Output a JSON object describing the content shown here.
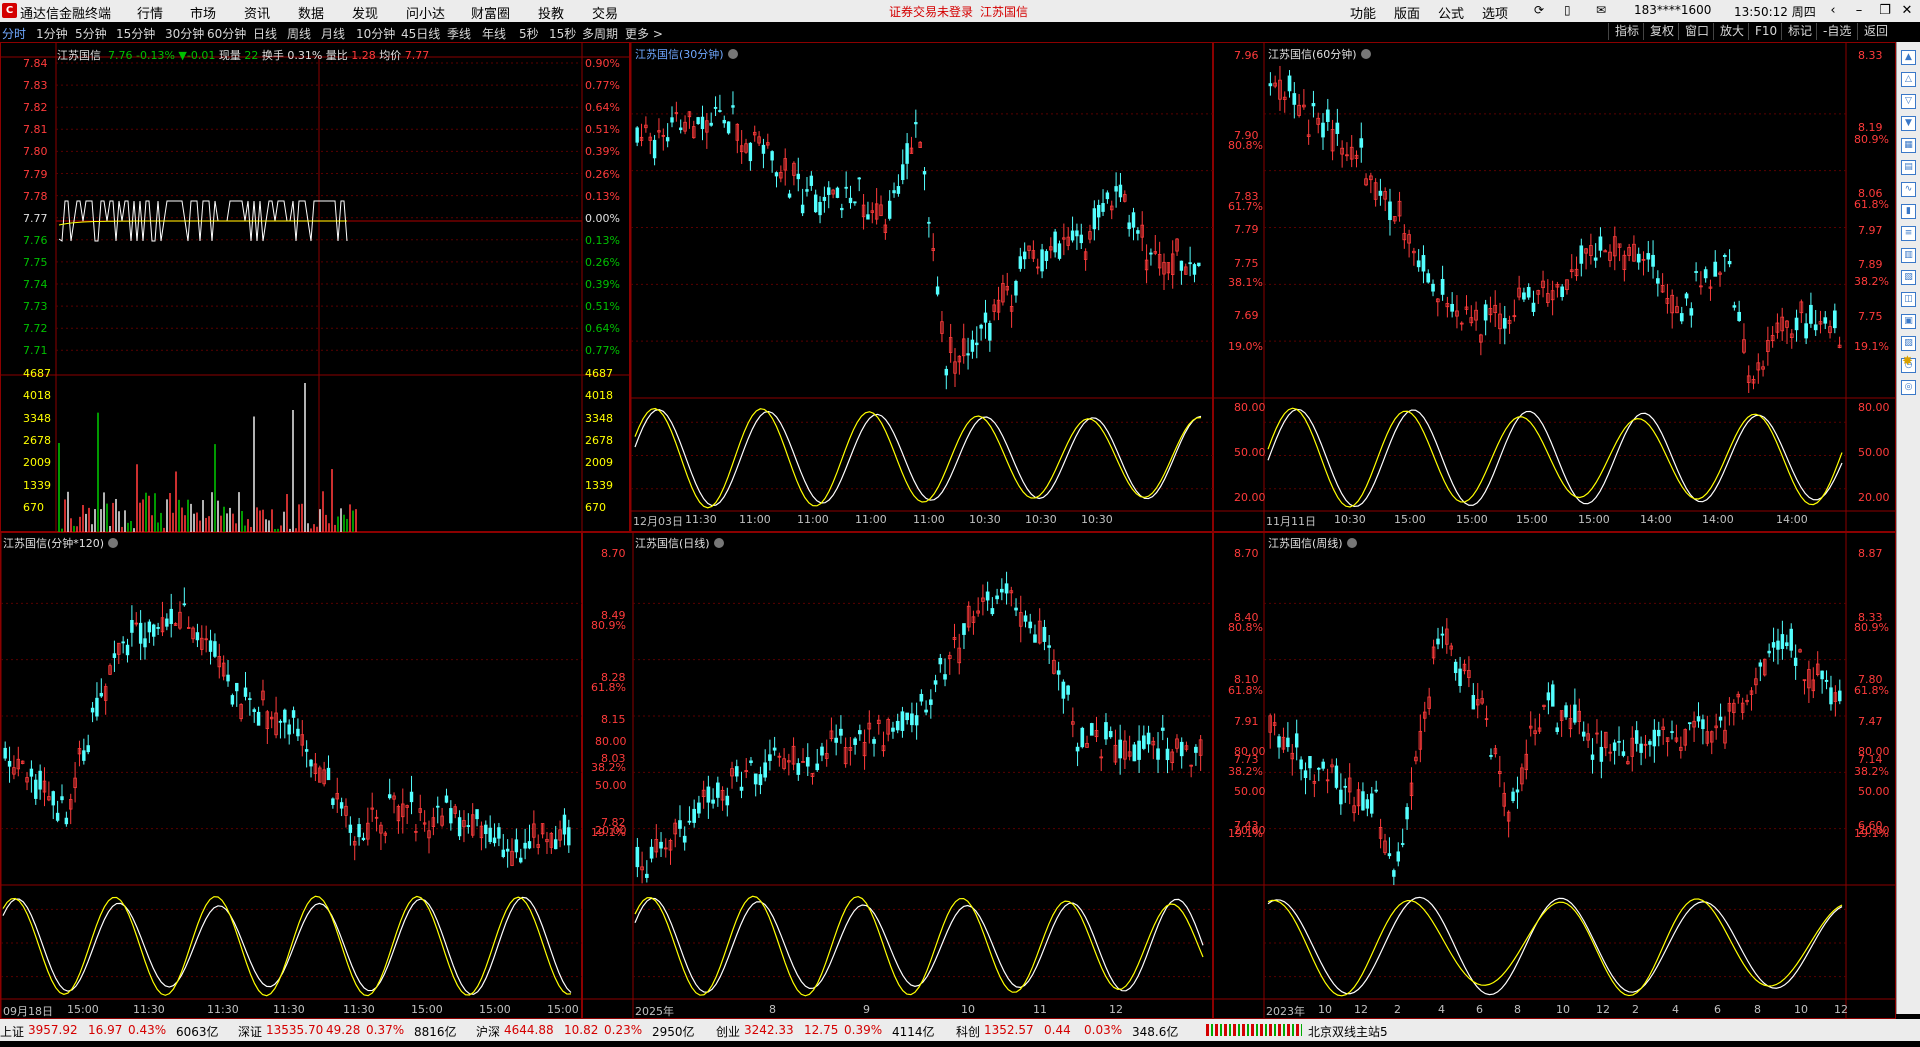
{
  "menubar": {
    "app_title": "通达信金融终端",
    "items": [
      "行情",
      "市场",
      "资讯",
      "数据",
      "发现",
      "问小达",
      "财富圈",
      "投教",
      "交易"
    ],
    "warning": "证券交易未登录",
    "stock": "江苏国信",
    "right_items": [
      "功能",
      "版面",
      "公式",
      "选项"
    ],
    "user": "183****1600",
    "clock": "13:50:12 周四"
  },
  "periodbar": {
    "periods": [
      "分时",
      "1分钟",
      "5分钟",
      "15分钟",
      "30分钟",
      "60分钟",
      "日线",
      "周线",
      "月线",
      "10分钟",
      "45日线",
      "季线",
      "年线",
      "5秒",
      "15秒",
      "多周期",
      "更多 >"
    ],
    "active": "分时",
    "right_buttons": [
      "指标",
      "复权",
      "窗口",
      "放大",
      "F10",
      "标记",
      "-自选",
      "返回"
    ]
  },
  "colors": {
    "up": "#ff3b3b",
    "down": "#54ffff",
    "grid": "#8b0000",
    "ma": "#ffff00",
    "price_line": "#ffffff"
  },
  "timeshare": {
    "name": "江苏国信",
    "price": "7.76",
    "pct": "-0.13%",
    "chg": "▼-0.01",
    "vol_label": "现量",
    "vol": "22",
    "turnover_label": "换手",
    "turnover": "0.31%",
    "ratio_label": "量比",
    "ratio": "1.28",
    "avg_label": "均价",
    "avg": "7.77",
    "price_ticks": [
      "7.84",
      "7.83",
      "7.82",
      "7.81",
      "7.80",
      "7.79",
      "7.78",
      "7.77",
      "7.76",
      "7.75",
      "7.74",
      "7.73",
      "7.72",
      "7.71"
    ],
    "pct_ticks": [
      "0.90%",
      "0.77%",
      "0.64%",
      "0.51%",
      "0.39%",
      "0.26%",
      "0.13%",
      "0.00%",
      "0.13%",
      "0.26%",
      "0.39%",
      "0.51%",
      "0.64%",
      "0.77%"
    ],
    "vol_ticks": [
      "4687",
      "4018",
      "3348",
      "2678",
      "2009",
      "1339",
      "670"
    ]
  },
  "panels": [
    {
      "title": "江苏国信(30分钟)",
      "price_ticks": [],
      "right_ticks": [],
      "osc_ticks": [],
      "xlabels": [
        "12月03日",
        "11:30",
        "11:00",
        "11:00",
        "11:00",
        "11:00",
        "10:30",
        "10:30",
        "10:30"
      ]
    },
    {
      "title": "江苏国信(60分钟)",
      "price_ticks": [
        "7.96",
        "7.90",
        "7.83",
        "7.79",
        "7.75",
        "7.69"
      ],
      "fib_left": [
        "80.8%",
        "61.7%",
        "38.1%",
        "19.0%"
      ],
      "right_ticks": [
        "8.33",
        "8.19",
        "8.06",
        "7.97",
        "7.89",
        "7.75"
      ],
      "fib_right": [
        "80.9%",
        "61.8%",
        "38.2%",
        "19.1%"
      ],
      "osc_left": [
        "80.00",
        "50.00",
        "20.00"
      ],
      "osc_right": [
        "80.00",
        "50.00",
        "20.00"
      ],
      "xlabels": [
        "11月11日",
        "10:30",
        "15:00",
        "15:00",
        "15:00",
        "15:00",
        "14:00",
        "14:00",
        "14:00"
      ]
    },
    {
      "title": "江苏国信(分钟*120)",
      "xlabels": [
        "09月18日",
        "15:00",
        "11:30",
        "11:30",
        "11:30",
        "11:30",
        "15:00",
        "15:00",
        "15:00"
      ]
    },
    {
      "title": "江苏国信(日线)",
      "price_ticks": [
        "8.70",
        "8.49",
        "8.28",
        "8.15",
        "8.03",
        "7.82"
      ],
      "fib_left": [
        "80.9%",
        "61.8%",
        "38.2%",
        "19.1%"
      ],
      "osc_left": [
        "80.00",
        "50.00",
        "20.00"
      ],
      "xlabels": [
        "2025年",
        "8",
        "9",
        "10",
        "11",
        "12"
      ]
    },
    {
      "title": "江苏国信(周线)",
      "price_ticks": [
        "8.70",
        "8.40",
        "8.10",
        "7.91",
        "7.73",
        "7.43"
      ],
      "fib_left": [
        "80.8%",
        "61.8%",
        "38.2%",
        "19.1%"
      ],
      "right_ticks": [
        "8.87",
        "8.33",
        "7.80",
        "7.47",
        "7.14",
        "6.60"
      ],
      "fib_right": [
        "80.9%",
        "61.8%",
        "38.2%",
        "19.1%"
      ],
      "osc_left": [
        "80.00",
        "50.00",
        "20.00"
      ],
      "osc_right": [
        "80.00",
        "50.00",
        "20.00"
      ],
      "xlabels": [
        "2023年",
        "10",
        "12",
        "2",
        "4",
        "6",
        "8",
        "10",
        "12",
        "2",
        "4",
        "6",
        "8",
        "10",
        "12"
      ]
    }
  ],
  "statusbar": {
    "items": [
      {
        "name": "上证",
        "value": "3957.92",
        "chg": "16.97",
        "pct": "0.43%",
        "amt": "6063亿"
      },
      {
        "name": "深证",
        "value": "13535.70",
        "chg": "49.28",
        "pct": "0.37%",
        "amt": "8816亿"
      },
      {
        "name": "沪深",
        "value": "4644.88",
        "chg": "10.82",
        "pct": "0.23%",
        "amt": "2950亿"
      },
      {
        "name": "创业",
        "value": "3242.33",
        "chg": "12.75",
        "pct": "0.39%",
        "amt": "4114亿"
      },
      {
        "name": "科创",
        "value": "1352.57",
        "chg": "0.44",
        "pct": "0.03%",
        "amt": "348.6亿"
      }
    ],
    "server": "北京双线主站5"
  }
}
